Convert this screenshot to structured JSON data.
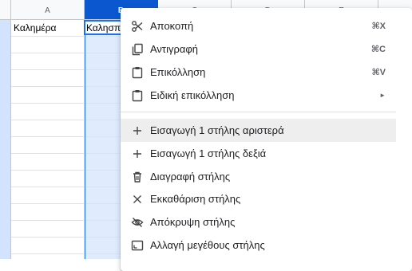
{
  "sheet": {
    "columns": [
      {
        "letter": "A",
        "selected": false
      },
      {
        "letter": "B",
        "selected": true
      },
      {
        "letter": "C",
        "selected": false
      },
      {
        "letter": "D",
        "selected": false
      },
      {
        "letter": "E",
        "selected": false
      }
    ],
    "cells": {
      "a1": "Καλημέρα",
      "b1": "Καλησπέρα"
    },
    "accent_color": "#0b57d0"
  },
  "menu": {
    "items": [
      {
        "label": "Αποκοπή",
        "shortcut": "⌘X",
        "icon": "cut-icon"
      },
      {
        "label": "Αντιγραφή",
        "shortcut": "⌘C",
        "icon": "copy-icon"
      },
      {
        "label": "Επικόλληση",
        "shortcut": "⌘V",
        "icon": "paste-icon"
      },
      {
        "label": "Ειδική επικόλληση",
        "submenu_arrow": "►",
        "icon": "paste-special-icon"
      },
      {
        "label": "Εισαγωγή 1 στήλης αριστερά",
        "icon": "plus-icon",
        "hovered": true
      },
      {
        "label": "Εισαγωγή 1 στήλης δεξιά",
        "icon": "plus-icon"
      },
      {
        "label": "Διαγραφή στήλης",
        "icon": "trash-icon"
      },
      {
        "label": "Εκκαθάριση στήλης",
        "icon": "close-icon"
      },
      {
        "label": "Απόκρυψη στήλης",
        "icon": "eye-off-icon"
      },
      {
        "label": "Αλλαγή μεγέθους στήλης",
        "icon": "resize-icon"
      }
    ]
  }
}
